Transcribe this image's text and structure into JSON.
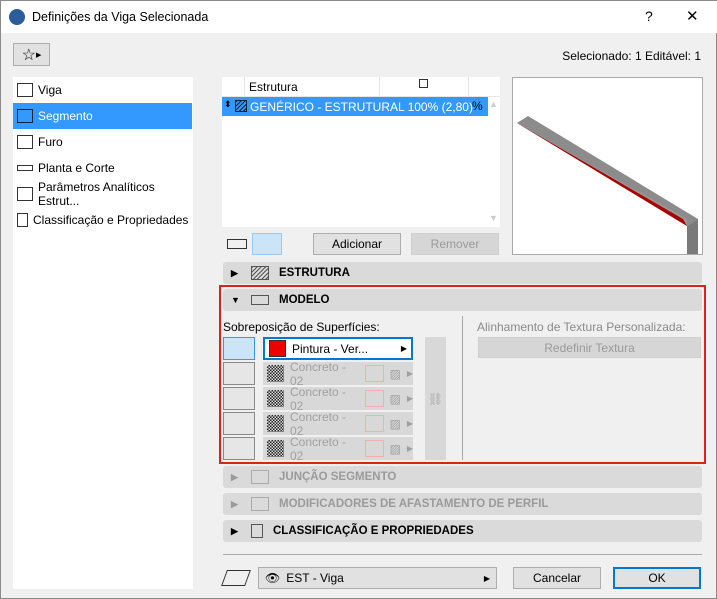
{
  "window": {
    "title": "Definições da Viga Selecionada",
    "help": "?",
    "close": "✕"
  },
  "status": "Selecionado: 1 Editável: 1",
  "sidebar": {
    "items": [
      {
        "label": "Viga"
      },
      {
        "label": "Segmento"
      },
      {
        "label": "Furo"
      },
      {
        "label": "Planta e Corte"
      },
      {
        "label": "Parâmetros Analíticos Estrut..."
      },
      {
        "label": "Classificação e Propriedades"
      }
    ]
  },
  "table": {
    "header": "Estrutura",
    "row": "GENÉRICO - ESTRUTURAL 100% (2,80)"
  },
  "buttons": {
    "add": "Adicionar",
    "remove": "Remover",
    "cancel": "Cancelar",
    "ok": "OK",
    "reset_texture": "Redefinir Textura"
  },
  "sections": {
    "estrutura": "ESTRUTURA",
    "modelo": "MODELO",
    "juncao": "JUNÇÃO SEGMENTO",
    "modificadores": "MODIFICADORES DE AFASTAMENTO DE PERFIL",
    "classificacao": "CLASSIFICAÇÃO E PROPRIEDADES"
  },
  "modelo": {
    "overlay_label": "Sobreposição de Superfícies:",
    "texture_label": "Alinhamento de Textura Personalizada:",
    "surfaces": [
      "Pintura - Ver...",
      "Concreto - 02",
      "Concreto - 02",
      "Concreto - 02",
      "Concreto - 02"
    ],
    "paint_color": "#ee0000"
  },
  "layer": {
    "value": "EST - Viga"
  }
}
